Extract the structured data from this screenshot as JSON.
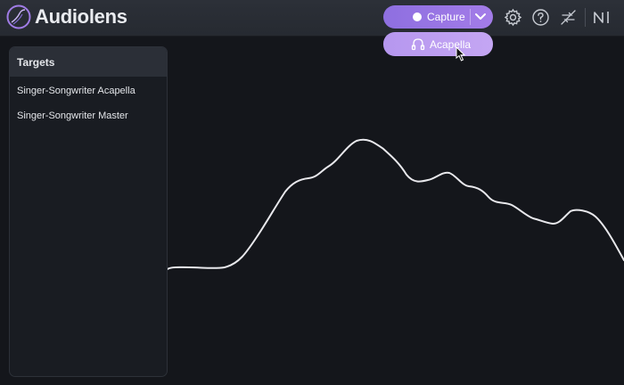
{
  "app": {
    "title": "Audiolens",
    "accent_color": "#9a76e6"
  },
  "header": {
    "capture_label": "Capture",
    "capture_state_icon": "record-dot-icon",
    "dropdown_toggle_icon": "chevron-down-icon",
    "dropdown_items": [
      {
        "label": "Acapella",
        "icon": "headphones-icon",
        "highlighted": true
      }
    ],
    "toolbar_icons": [
      "gear-icon",
      "help-icon",
      "no-sync-icon",
      "ni-logo-icon"
    ]
  },
  "targets": {
    "title": "Targets",
    "items": [
      {
        "label": "Singer-Songwriter Acapella"
      },
      {
        "label": "Singer-Songwriter Master"
      }
    ]
  },
  "spectrum": {
    "line_color": "#e8e8ec"
  }
}
